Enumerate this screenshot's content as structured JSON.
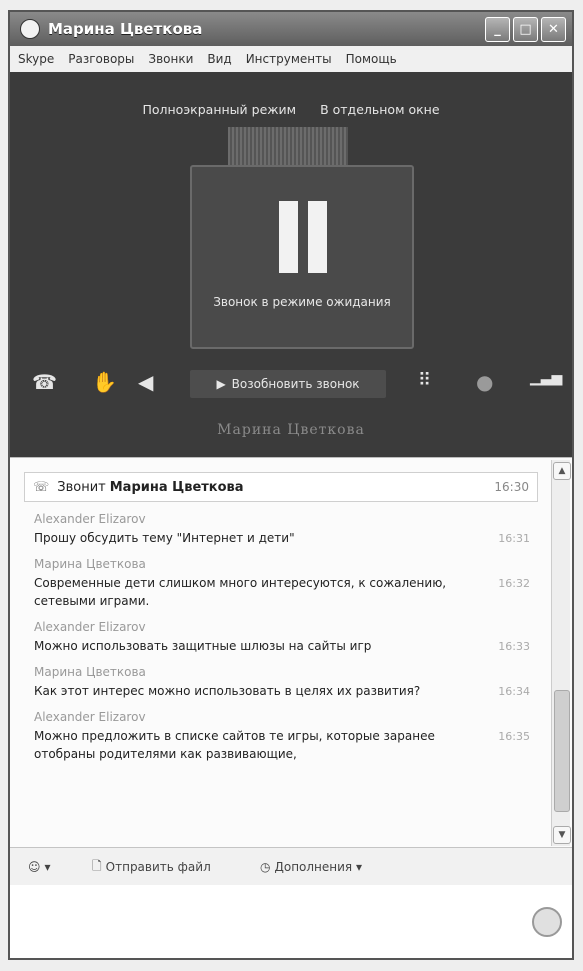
{
  "window": {
    "title": "Марина Цветкова"
  },
  "menu": [
    "Skype",
    "Разговоры",
    "Звонки",
    "Вид",
    "Инструменты",
    "Помощь"
  ],
  "video": {
    "fullscreen_label": "Полноэкранный режим",
    "separate_window_label": "В отдельном окне",
    "hold_text": "Звонок в режиме ожидания",
    "resume_label": "Возобновить звонок",
    "caller_name": "Марина Цветкова"
  },
  "chat": {
    "call_prefix": "Звонит",
    "caller": "Марина Цветкова",
    "call_time": "16:30",
    "messages": [
      {
        "author": "Alexander Elizarov",
        "text": "Прошу обсудить тему \"Интернет и дети\"",
        "time": "16:31"
      },
      {
        "author": "Марина Цветкова",
        "text": "Современные дети слишком много интересуются, к сожалению, сетевыми играми.",
        "time": "16:32"
      },
      {
        "author": "Alexander Elizarov",
        "text": "Можно использовать защитные шлюзы на сайты игр",
        "time": "16:33"
      },
      {
        "author": "Марина Цветкова",
        "text": "Как этот интерес можно использовать в целях их развития?",
        "time": "16:34"
      },
      {
        "author": "Alexander Elizarov",
        "text": "Можно предложить в списке сайтов те игры, которые заранее отобраны родителями как развивающие,",
        "time": "16:35"
      }
    ]
  },
  "toolbar": {
    "emoticon_label": "▾",
    "send_file_label": "Отправить файл",
    "extras_label": "Дополнения ▾"
  }
}
